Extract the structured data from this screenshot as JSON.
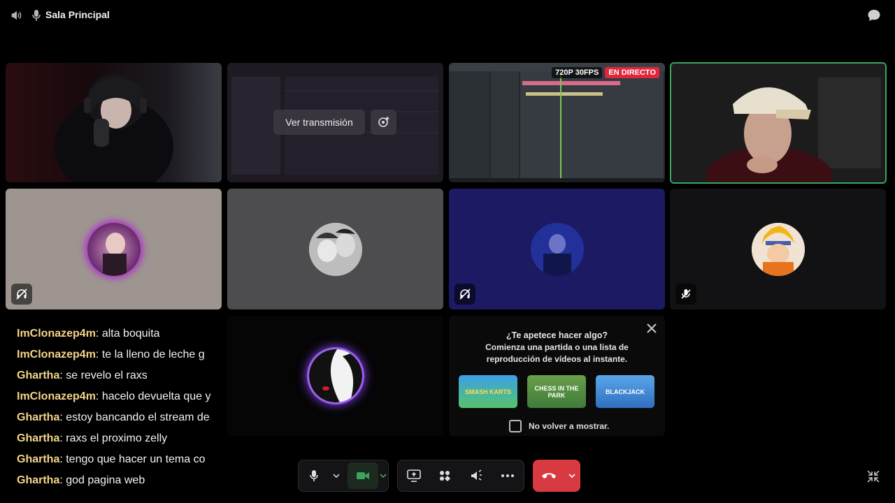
{
  "header": {
    "channel_name": "Sala Principal",
    "icons": [
      "speaker-icon",
      "voice-channel-icon",
      "chat-bubble-icon"
    ]
  },
  "stream_tile": {
    "watch_label": "Ver transmisión"
  },
  "live_tile": {
    "quality_label": "720P 30FPS",
    "live_label": "EN DIRECTO"
  },
  "chat": [
    {
      "user": "ImClonazep4m",
      "message": "alta boquita"
    },
    {
      "user": "ImClonazep4m",
      "message": "te la lleno de leche g"
    },
    {
      "user": "Ghartha",
      "message": "se revelo el raxs"
    },
    {
      "user": "ImClonazep4m",
      "message": "hacelo devuelta que y"
    },
    {
      "user": "Ghartha",
      "message": "estoy bancando el stream de"
    },
    {
      "user": "Ghartha",
      "message": "raxs el proximo zelly"
    },
    {
      "user": "Ghartha",
      "message": "tengo que hacer un tema co"
    },
    {
      "user": "Ghartha",
      "message": "god pagina web"
    }
  ],
  "activity_prompt": {
    "question": "¿Te apetece hacer algo?",
    "line1": "Comienza una partida o una lista de",
    "line2": "reproducción de vídeos al instante.",
    "games": [
      {
        "name": "SMASH KARTS"
      },
      {
        "name": "CHESS IN THE PARK"
      },
      {
        "name": "BLACKJACK"
      }
    ],
    "dont_show_label": "No volver a mostrar."
  },
  "colors": {
    "speaking_border": "#3ba55c",
    "live_badge": "#e1263b",
    "end_call": "#d83a42",
    "chat_username": "#f5d58a"
  }
}
